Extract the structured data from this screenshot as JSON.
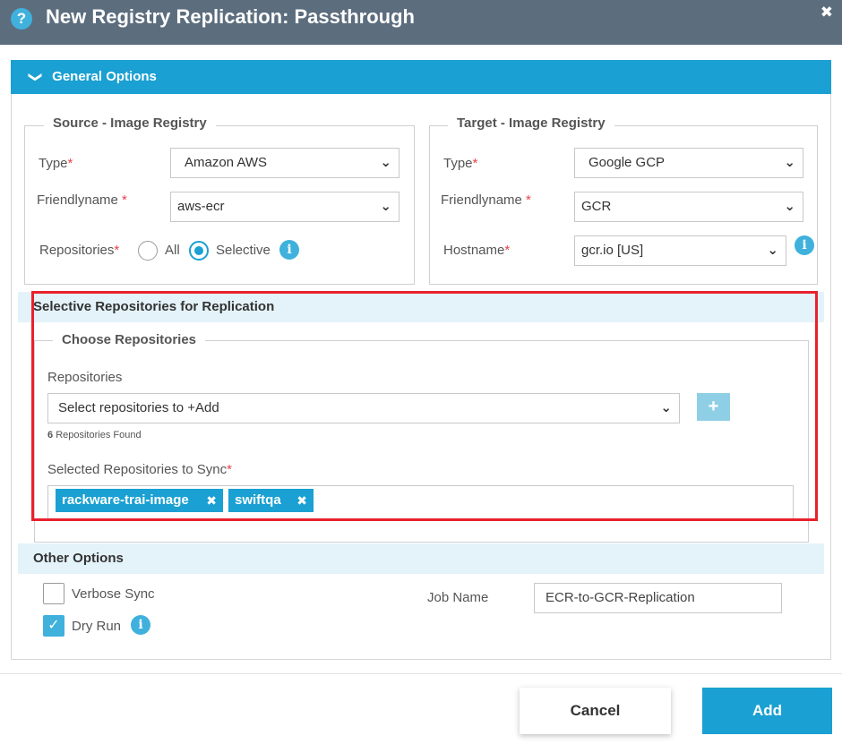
{
  "dialog": {
    "title": "New Registry Replication: Passthrough",
    "close_glyph": "✖",
    "help_glyph": "?"
  },
  "general_options": {
    "label": "General Options",
    "chevron": "❯"
  },
  "source": {
    "legend": "Source - Image Registry",
    "type_label": "Type",
    "type_value": "Amazon AWS",
    "friendlyname_label": "Friendlyname",
    "friendlyname_value": "aws-ecr",
    "repositories_label": "Repositories",
    "radio_all": "All",
    "radio_selective": "Selective",
    "selected_radio": "Selective"
  },
  "target": {
    "legend": "Target - Image Registry",
    "type_label": "Type",
    "type_value": "Google GCP",
    "friendlyname_label": "Friendlyname",
    "friendlyname_value": "GCR",
    "hostname_label": "Hostname",
    "hostname_value": "gcr.io [US]"
  },
  "selective": {
    "section_title": "Selective Repositories for Replication",
    "choose_legend": "Choose Repositories",
    "repositories_label": "Repositories",
    "repositories_placeholder": "Select repositories to +Add",
    "found_count": "6",
    "found_text": "Repositories Found",
    "add_glyph": "+",
    "selected_label": "Selected Repositories to Sync",
    "selected_tags": [
      "rackware-trai-image",
      "swiftqa"
    ],
    "tag_remove_glyph": "✖"
  },
  "other": {
    "section_title": "Other Options",
    "verbose_label": "Verbose Sync",
    "verbose_checked": false,
    "dryrun_label": "Dry Run",
    "dryrun_checked": true,
    "jobname_label": "Job Name",
    "jobname_value": "ECR-to-GCR-Replication"
  },
  "footer": {
    "cancel_label": "Cancel",
    "add_label": "Add"
  },
  "colors": {
    "title_bar": "#5c6d7e",
    "accent": "#1aa0d2",
    "required": "#e8424a",
    "highlight_box": "#e8212d"
  }
}
